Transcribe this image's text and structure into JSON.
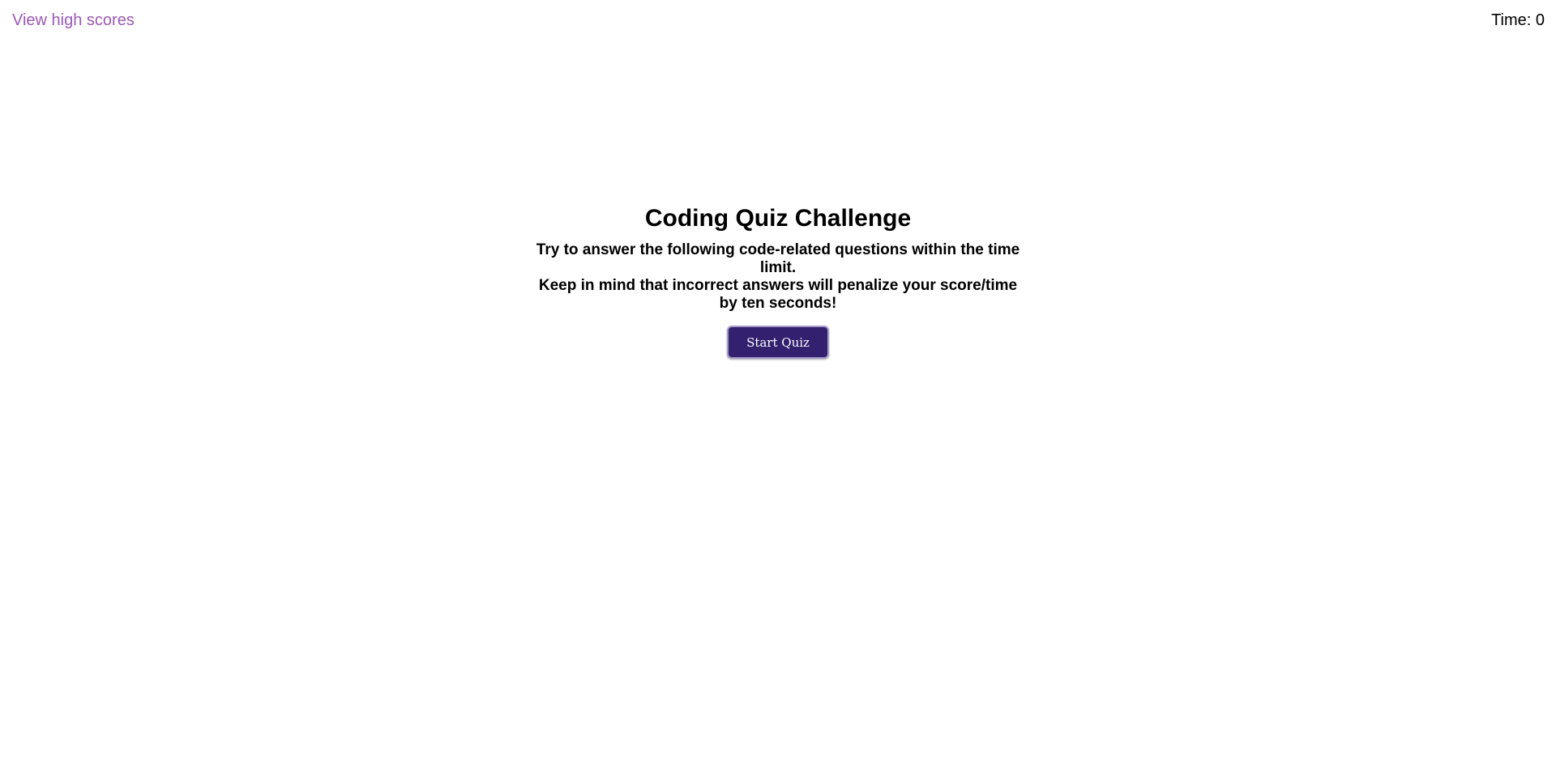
{
  "header": {
    "highscores_link": "View high scores",
    "timer_label": "Time: 0"
  },
  "intro": {
    "title": "Coding Quiz Challenge",
    "description_lines": [
      "Try to answer the following code-related questions within the time limit.",
      "Keep in mind that incorrect answers will penalize your score/time",
      "by ten seconds!"
    ],
    "start_button_label": "Start Quiz"
  },
  "colors": {
    "link": "#9b59b6",
    "button_bg": "#33206e",
    "button_border": "#a79cc8",
    "text": "#000000",
    "background": "#ffffff"
  }
}
